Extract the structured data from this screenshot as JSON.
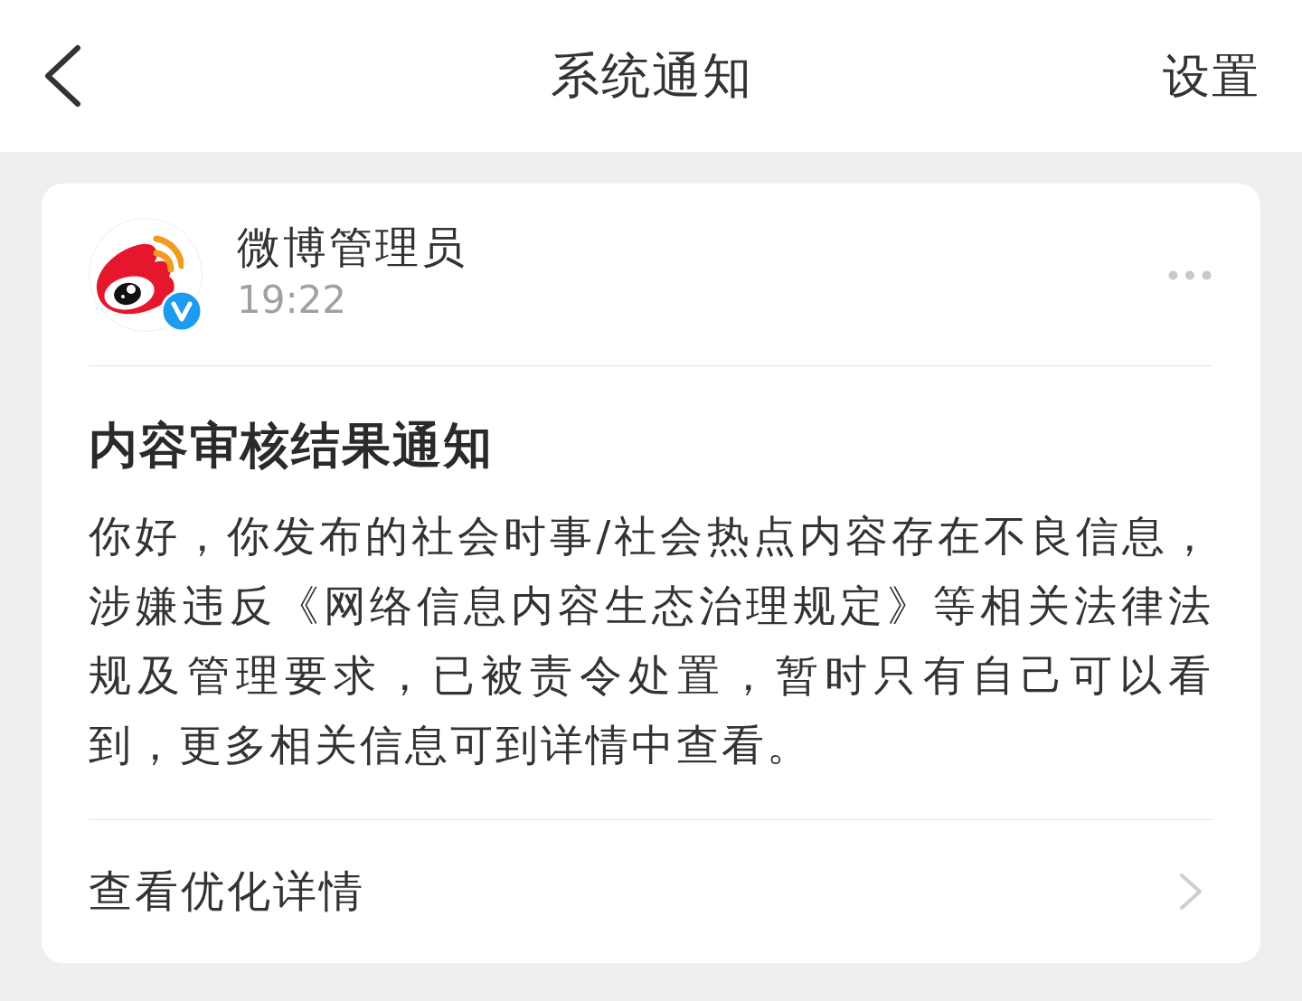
{
  "header": {
    "title": "系统通知",
    "settings": "设置"
  },
  "notification": {
    "sender": {
      "name": "微博管理员",
      "verified": true
    },
    "time": "19:22",
    "title": "内容审核结果通知",
    "body": "你好，你发布的社会时事/社会热点内容存在不良信息，涉嫌违反《网络信息内容生态治理规定》等相关法律法规及管理要求，已被责令处置，暂时只有自己可以看到，更多相关信息可到详情中查看。",
    "link": "查看优化详情"
  }
}
